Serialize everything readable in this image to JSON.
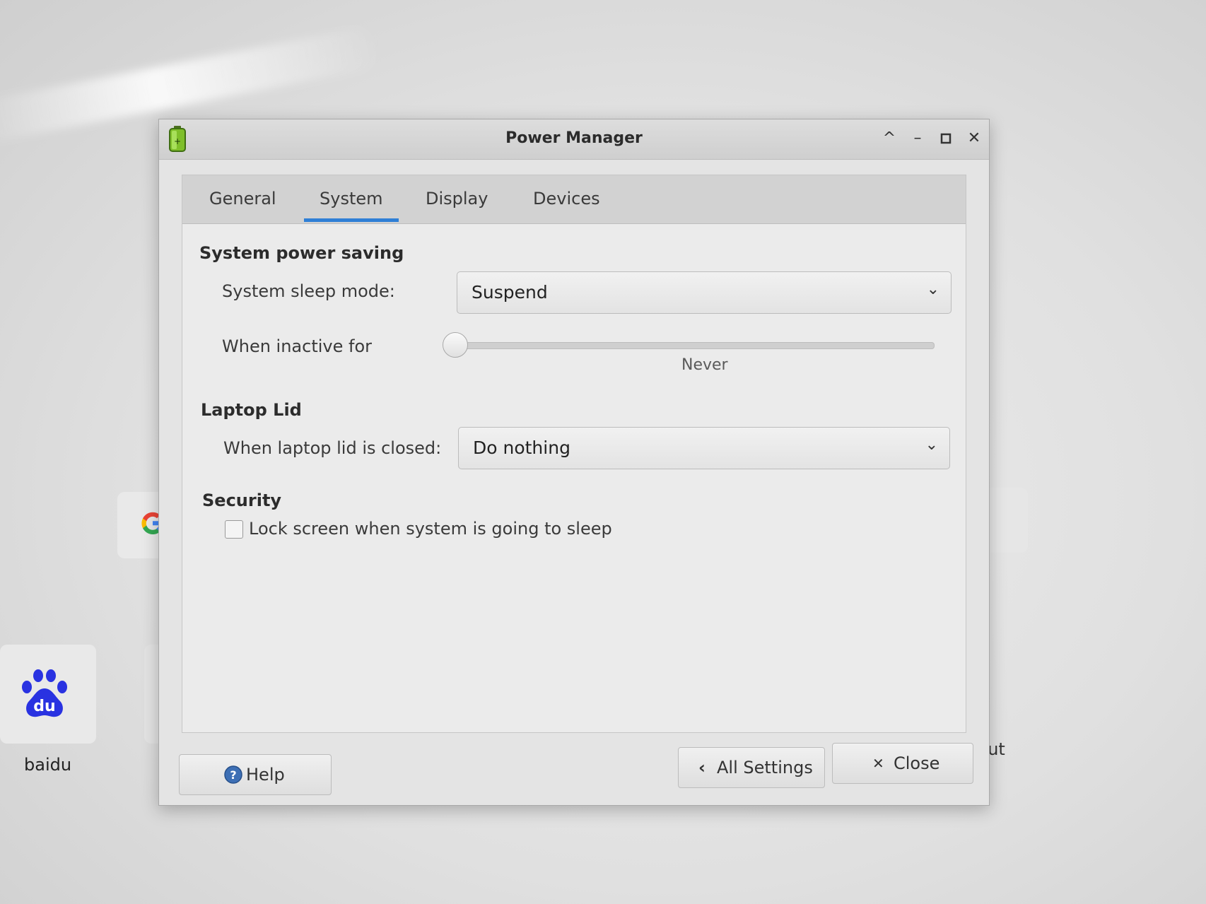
{
  "window": {
    "title": "Power Manager"
  },
  "tabs": [
    {
      "label": "General",
      "active": false
    },
    {
      "label": "System",
      "active": true
    },
    {
      "label": "Display",
      "active": false
    },
    {
      "label": "Devices",
      "active": false
    }
  ],
  "system_power_saving": {
    "heading": "System power saving",
    "sleep_mode_label": "System sleep mode:",
    "sleep_mode_value": "Suspend",
    "inactive_label": "When inactive for",
    "inactive_value": "Never",
    "inactive_slider_fraction": 0
  },
  "laptop_lid": {
    "heading": "Laptop Lid",
    "lid_closed_label": "When laptop lid is closed:",
    "lid_closed_value": "Do nothing"
  },
  "security": {
    "heading": "Security",
    "lock_screen_label": "Lock screen when system is going to sleep",
    "lock_screen_checked": false
  },
  "buttons": {
    "help": "Help",
    "all_settings": "All Settings",
    "close": "Close"
  },
  "desktop": {
    "baidu_label": "baidu",
    "cut_label": "cut"
  },
  "colors": {
    "tab_indicator": "#2f7fd6",
    "baidu_blue": "#2932e1"
  }
}
